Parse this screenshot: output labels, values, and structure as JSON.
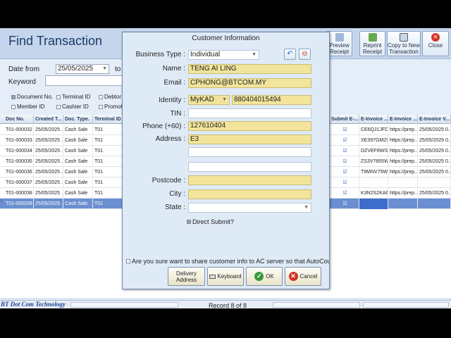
{
  "header": {
    "title": "Find Transaction",
    "buttons": {
      "preview": "Preview Receipt",
      "reprint": "Reprint Receipt",
      "copy": "Copy to New Transaction",
      "close": "Close"
    }
  },
  "filters": {
    "date_from_label": "Date from",
    "date_from_value": "25/05/2025",
    "to_label": "to",
    "keyword_label": "Keyword",
    "checks": [
      {
        "label": "Document No.",
        "checked": true
      },
      {
        "label": "Terminal ID",
        "checked": false
      },
      {
        "label": "Debtor C",
        "checked": false
      },
      {
        "label": "Member ID",
        "checked": false
      },
      {
        "label": "Cashier ID",
        "checked": false
      },
      {
        "label": "Promot",
        "checked": false
      }
    ]
  },
  "grid": {
    "left_columns": [
      "Doc No.",
      "Created T...",
      "Doc. Type.",
      "Terminal ID"
    ],
    "right_columns": [
      "Submit E-...",
      "E-Invoice ...",
      "E-Invoice ...",
      "E-Invoice V..."
    ],
    "rows": [
      {
        "doc": "T01-000032",
        "date": "25/05/2025 ...",
        "type": "Cash Sale",
        "terminal": "T01",
        "submit": "☑",
        "inv1": "CE6QJ1JFD...",
        "inv2": "https://prep...",
        "inv3": "25/05/2025 0..."
      },
      {
        "doc": "T01-000033",
        "date": "25/05/2025 ...",
        "type": "Cash Sale",
        "terminal": "T01",
        "submit": "☑",
        "inv1": "XE397GM2S...",
        "inv2": "https://prep...",
        "inv3": "25/05/2025 0..."
      },
      {
        "doc": "T01-000034",
        "date": "25/05/2025 ...",
        "type": "Cash Sale",
        "terminal": "T01",
        "submit": "☑",
        "inv1": "DZVEF8WS9...",
        "inv2": "https://prep...",
        "inv3": "25/05/2025 0..."
      },
      {
        "doc": "T01-000035",
        "date": "25/05/2025 ...",
        "type": "Cash Sale",
        "terminal": "T01",
        "submit": "☑",
        "inv1": "ZS3V7855W...",
        "inv2": "https://prep...",
        "inv3": "25/05/2025 0..."
      },
      {
        "doc": "T01-000036",
        "date": "25/05/2025 ...",
        "type": "Cash Sale",
        "terminal": "T01",
        "submit": "☑",
        "inv1": "T9MNV75W...",
        "inv2": "https://prep...",
        "inv3": "25/05/2025 0..."
      },
      {
        "doc": "T01-000037",
        "date": "25/05/2025 ...",
        "type": "Cash Sale",
        "terminal": "T01",
        "submit": "☑",
        "inv1": "",
        "inv2": "",
        "inv3": ""
      },
      {
        "doc": "T01-000038",
        "date": "25/05/2025 ...",
        "type": "Cash Sale",
        "terminal": "T01",
        "submit": "☑",
        "inv1": "K3N2S2KA6...",
        "inv2": "https://prep...",
        "inv3": "25/05/2025 0..."
      },
      {
        "doc": "T01-000039",
        "date": "25/05/2025 ...",
        "type": "Cash Sale",
        "terminal": "T01",
        "submit": "☑",
        "inv1": "",
        "inv2": "",
        "inv3": ""
      }
    ]
  },
  "status": {
    "brand": "BT Dot Com Technology",
    "record": "Record 8 of 8"
  },
  "dialog": {
    "title": "Customer Information",
    "business_type_label": "Business Type :",
    "business_type_value": "Individual",
    "name_label": "Name :",
    "name_value": "TENG AI LING",
    "email_label": "Email :",
    "email_value": "CPHONG@BTCOM.MY",
    "identity_label": "Identity :",
    "identity_type": "MyKAD",
    "identity_value": "880404015494",
    "tin_label": "TIN :",
    "tin_value": "",
    "phone_label": "Phone (+60) :",
    "phone_value": "127610404",
    "address_label": "Address :",
    "address_value": "E3",
    "postcode_label": "Postcode :",
    "city_label": "City :",
    "state_label": "State :",
    "direct_submit_label": "Direct Submit?",
    "share_label": "Are you sure want to share customer info to AC server so that AutoCount user",
    "buttons": {
      "delivery": "Delivery Address",
      "keyboard": "Keyboard",
      "ok": "OK",
      "cancel": "Cancel"
    }
  }
}
